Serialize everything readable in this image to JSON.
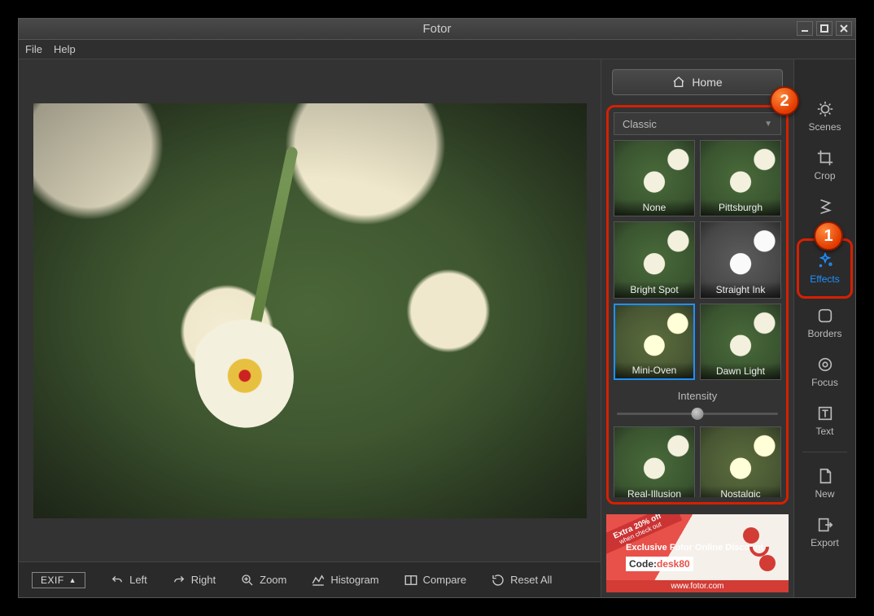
{
  "window": {
    "title": "Fotor"
  },
  "menu": {
    "file": "File",
    "help": "Help"
  },
  "toolbar": {
    "exif": "EXIF",
    "left": "Left",
    "right": "Right",
    "zoom": "Zoom",
    "histogram": "Histogram",
    "compare": "Compare",
    "reset": "Reset All"
  },
  "home": {
    "label": "Home"
  },
  "effects": {
    "category": "Classic",
    "intensity_label": "Intensity",
    "intensity_value": 50,
    "presets": [
      {
        "name": "None",
        "style": ""
      },
      {
        "name": "Pittsburgh",
        "style": ""
      },
      {
        "name": "Bright Spot",
        "style": ""
      },
      {
        "name": "Straight Ink",
        "style": "bw"
      },
      {
        "name": "Mini-Oven",
        "style": "warm",
        "selected": true
      },
      {
        "name": "Dawn Light",
        "style": ""
      },
      {
        "name": "Real-Illusion",
        "style": ""
      },
      {
        "name": "Nostalgic",
        "style": "warm"
      },
      {
        "name": "",
        "style": ""
      },
      {
        "name": "",
        "style": ""
      }
    ]
  },
  "tabs": {
    "scenes": "Scenes",
    "crop": "Crop",
    "adjust": "Adjust",
    "effects": "Effects",
    "borders": "Borders",
    "focus": "Focus",
    "text": "Text",
    "new": "New",
    "export": "Export"
  },
  "ad": {
    "ribbon_top": "Extra 20% off",
    "ribbon_sub": "when check out",
    "line": "Exclusive Fotor Online Discount",
    "code_label": "Code:",
    "code_value": "desk80",
    "url": "www.fotor.com"
  },
  "markers": {
    "one": "1",
    "two": "2"
  }
}
